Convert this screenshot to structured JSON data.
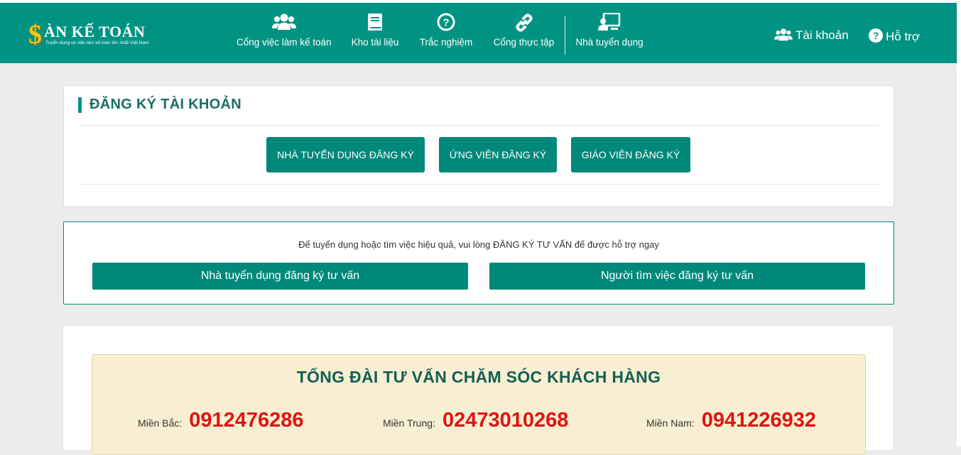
{
  "brand": {
    "dollar": "$",
    "name": "ÀN KẾ TOÁN",
    "tagline": "Tuyển dụng và việc làm kế toán lớn nhất Việt Nam"
  },
  "nav": {
    "items": [
      {
        "label": "Cổng việc làm kế toán",
        "icon": "users-icon"
      },
      {
        "label": "Kho tài liệu",
        "icon": "book-icon"
      },
      {
        "label": "Trắc nghiệm",
        "icon": "question-circle-icon"
      },
      {
        "label": "Cổng thực tập",
        "icon": "link-icon"
      },
      {
        "label": "Nhà tuyển dụng",
        "icon": "presentation-icon"
      }
    ],
    "account": "Tài khoản",
    "support": "Hỗ trợ"
  },
  "register": {
    "title": "ĐĂNG KÝ TÀI KHOẢN",
    "employer_btn": "NHÀ TUYỂN DỤNG ĐĂNG KÝ",
    "candidate_btn": "ỨNG VIÊN ĐĂNG KÝ",
    "teacher_btn": "GIÁO VIÊN ĐĂNG KÝ"
  },
  "advice": {
    "text": "Để tuyển dụng hoặc tìm việc hiệu quả, vui lòng ĐĂNG KÝ TƯ VẤN để được hỗ trợ ngay",
    "employer_btn": "Nhà tuyển dụng đăng ký tư vấn",
    "seeker_btn": "Người tìm việc đăng ký tư vấn"
  },
  "hotline": {
    "title": "TỔNG ĐÀI TƯ VẤN CHĂM SÓC KHÁCH HÀNG",
    "regions": [
      {
        "label": "Miền Bắc:",
        "number": "0912476286"
      },
      {
        "label": "Miền Trung:",
        "number": "02473010268"
      },
      {
        "label": "Miền Nam:",
        "number": "0941226932"
      }
    ]
  },
  "colors": {
    "brand_teal": "#009383",
    "button_teal": "#00897b",
    "hotline_bg": "#f8efd2",
    "phone_red": "#e01313"
  }
}
